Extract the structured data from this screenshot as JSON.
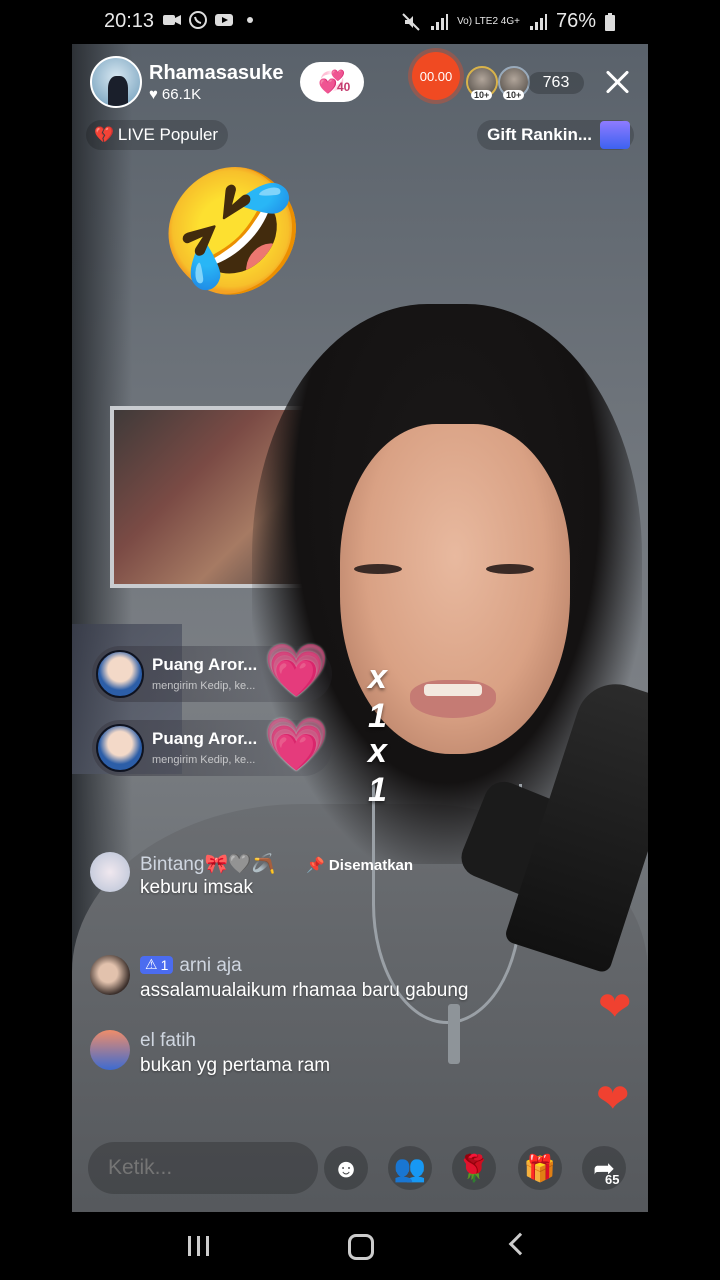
{
  "status_bar": {
    "time": "20:13",
    "notification_icons": [
      "video-icon",
      "whatsapp-icon",
      "youtube-icon",
      "dot-icon"
    ],
    "right_icons": [
      "mute-icon",
      "signal-icon",
      "volte-icon",
      "signal-icon-2"
    ],
    "network_label": "Vo) LTE2 4G+",
    "battery": "76%"
  },
  "host": {
    "name": "Rhamasasuke",
    "likes": "66.1K"
  },
  "follow_badge": {
    "count": "40"
  },
  "timer": "00.00",
  "viewers": {
    "badges": [
      "10+",
      "10+"
    ],
    "count": "763"
  },
  "live_popular": "LIVE Populer",
  "gift_ranking": "Gift Rankin...",
  "emoji": "🤣",
  "gifts": [
    {
      "name": "Puang Aror...",
      "sub": "mengirim Kedip, ke...",
      "multiplier": "x 1"
    },
    {
      "name": "Puang Aror...",
      "sub": "mengirim Kedip, ke...",
      "multiplier": "x 1"
    }
  ],
  "comments": [
    {
      "user": "Bintang🎀🩶🪃",
      "text": "keburu imsak",
      "pinned": "Disematkan"
    },
    {
      "user": "arni aja",
      "level": "1",
      "text": "assalamualaikum rhamaa baru gabung"
    },
    {
      "user": "el fatih",
      "text": "bukan yg pertama ram"
    }
  ],
  "input": {
    "placeholder": "Ketik..."
  },
  "share_count": "65",
  "colors": {
    "timer": "#f04a22",
    "heart": "#f04130",
    "level_badge": "#4b6cf0"
  }
}
